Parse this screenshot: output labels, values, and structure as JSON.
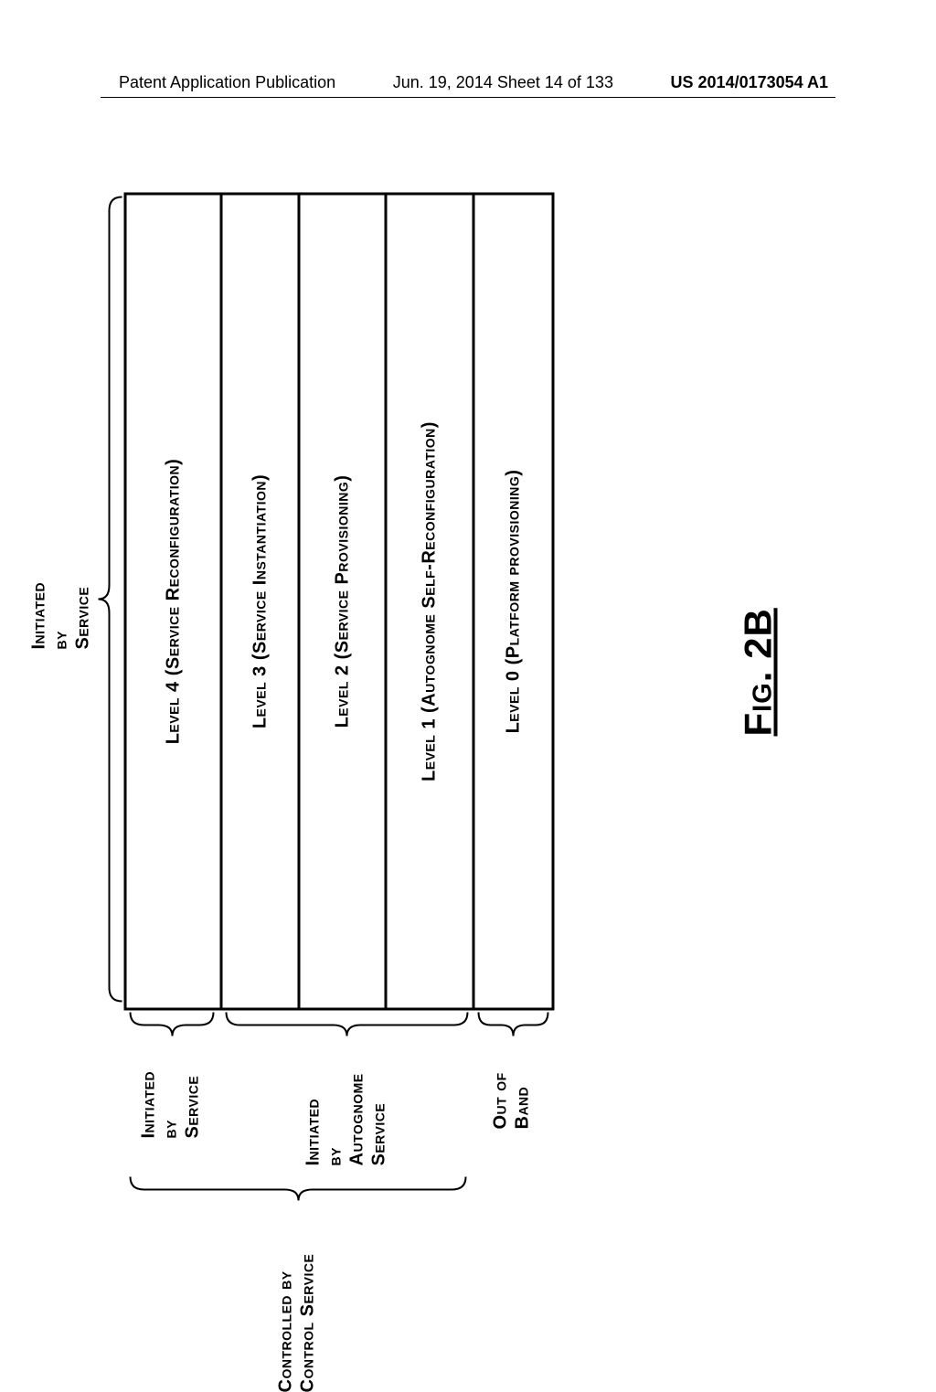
{
  "header": {
    "left": "Patent Application Publication",
    "center": "Jun. 19, 2014  Sheet 14 of 133",
    "right": "US 2014/0173054 A1"
  },
  "levels": {
    "level4": "Level 4 (Service Reconfiguration)",
    "level3": "Level 3 (Service Instantiation)",
    "level2": "Level 2 (Service Provisioning)",
    "level1": "Level 1 (Autognome Self-Reconfiguration)",
    "level0": "Level 0 (Platform provisioning)"
  },
  "brackets": {
    "initiated_service": "Initiated\nby\nService",
    "initiated_autognome": "Initiated\nby\nAutognome\nService",
    "out_of_band": "Out of\nBand",
    "controlled_by": "Controlled by\nControl Service"
  },
  "figure_label": "Fig. 2B"
}
